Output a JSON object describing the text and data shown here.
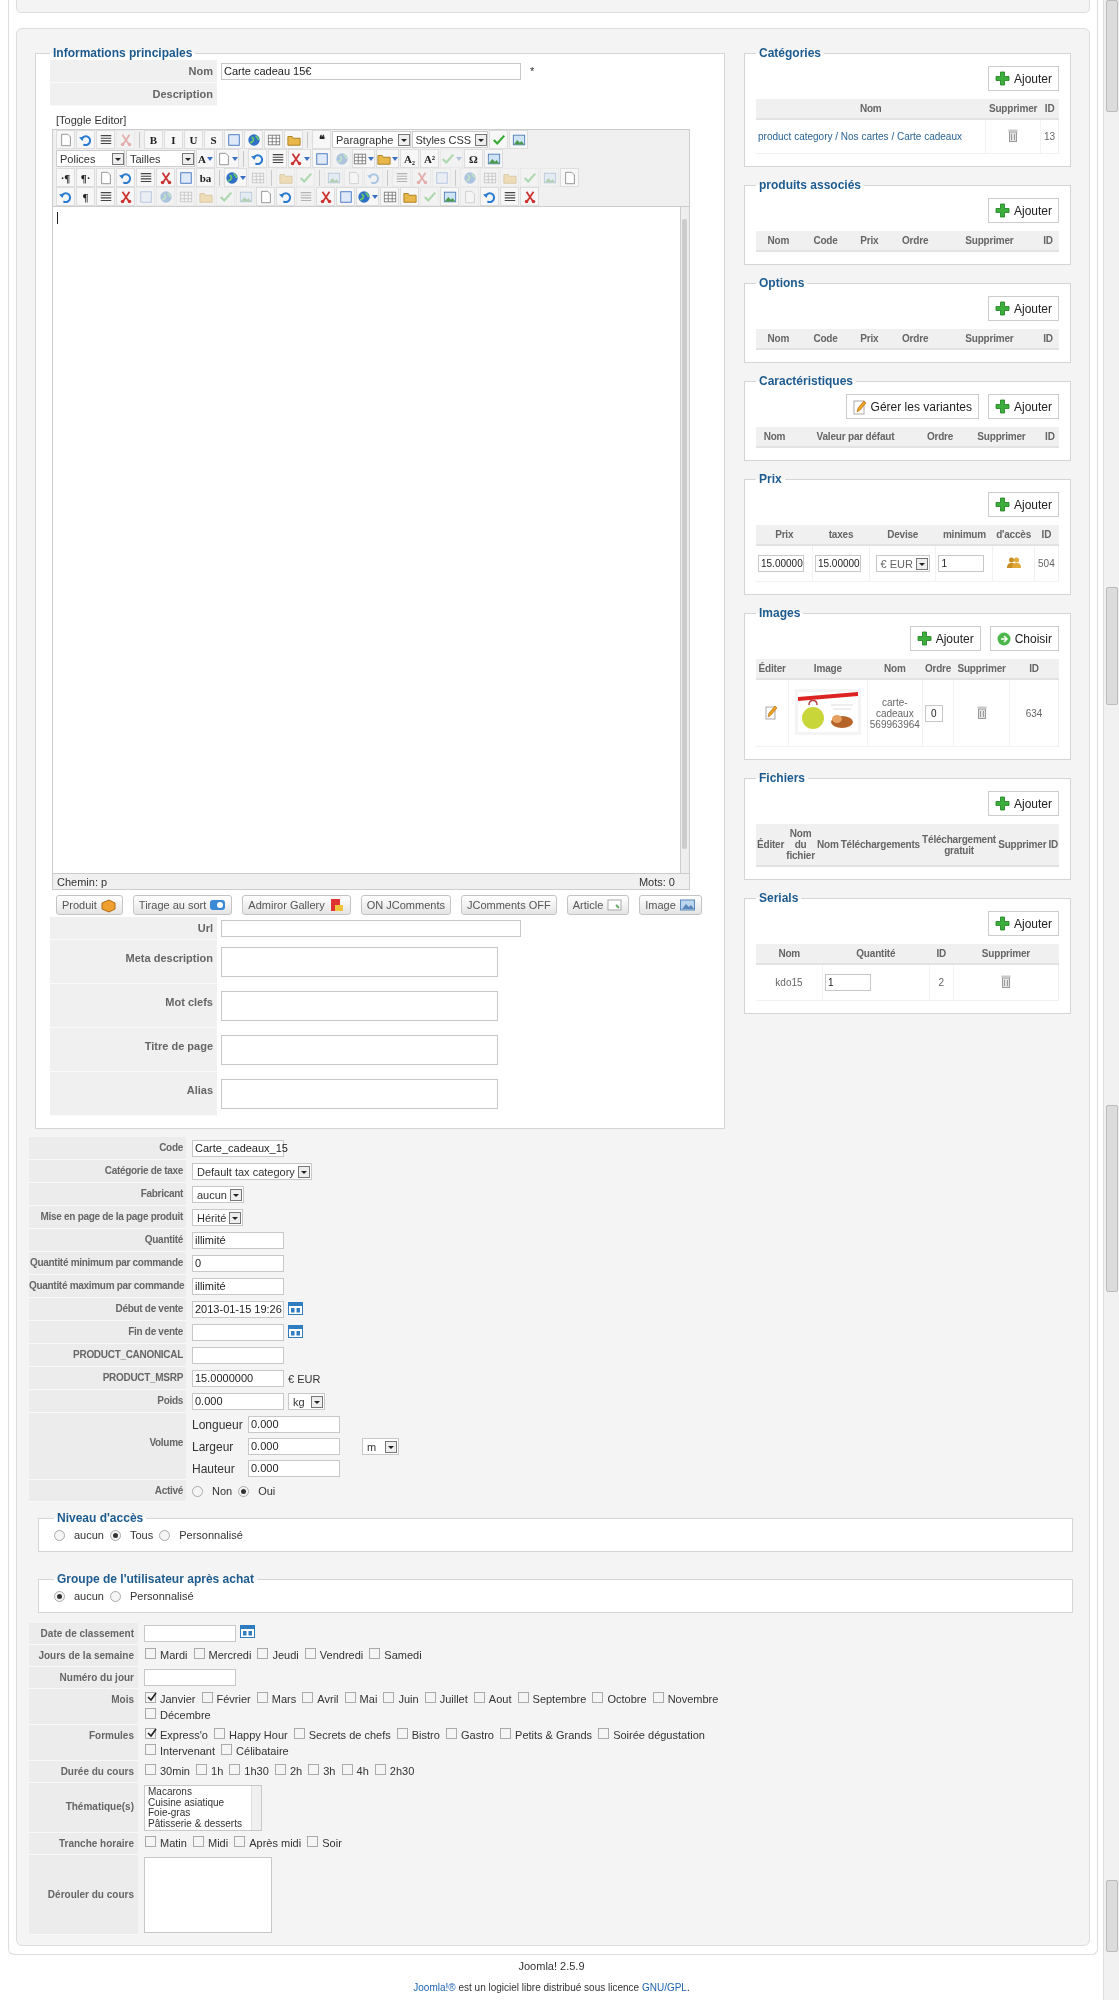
{
  "main_info": {
    "legend": "Informations principales",
    "name_field": {
      "label": "Nom",
      "value": "Carte cadeau 15€",
      "required_mark": "*"
    },
    "description_label": "Description",
    "editor": {
      "toggle": "[Toggle Editor]",
      "path": "Chemin: p",
      "word_count": "Mots: 0",
      "toolbar": [
        [
          {
            "kind": "btn",
            "disabled": false
          },
          {
            "kind": "btn",
            "disabled": false
          },
          {
            "kind": "btn",
            "disabled": false
          },
          {
            "kind": "btn",
            "disabled": true
          },
          {
            "kind": "sep"
          },
          {
            "kind": "btn",
            "glyph": "B",
            "disabled": false
          },
          {
            "kind": "btn",
            "glyph": "I",
            "disabled": false
          },
          {
            "kind": "btn",
            "glyph": "U",
            "disabled": false
          },
          {
            "kind": "btn",
            "glyph": "S",
            "disabled": false
          },
          {
            "kind": "btn",
            "disabled": false
          },
          {
            "kind": "btn",
            "disabled": false
          },
          {
            "kind": "btn",
            "disabled": false
          },
          {
            "kind": "btn",
            "disabled": false
          },
          {
            "kind": "sep"
          },
          {
            "kind": "btn",
            "glyph": "❝",
            "disabled": false
          },
          {
            "kind": "select",
            "value": "Paragraphe"
          },
          {
            "kind": "select",
            "value": "Styles CSS"
          },
          {
            "kind": "btn",
            "disabled": false
          },
          {
            "kind": "btn",
            "disabled": false
          }
        ],
        [
          {
            "kind": "select",
            "value": "Polices"
          },
          {
            "kind": "select",
            "value": "Tailles"
          },
          {
            "kind": "split",
            "glyph": "A",
            "disabled": false
          },
          {
            "kind": "split",
            "disabled": false
          },
          {
            "kind": "sep"
          },
          {
            "kind": "btn",
            "disabled": false
          },
          {
            "kind": "btn",
            "disabled": false
          },
          {
            "kind": "split",
            "disabled": false
          },
          {
            "kind": "btn",
            "disabled": false
          },
          {
            "kind": "btn",
            "disabled": true
          },
          {
            "kind": "split",
            "disabled": false
          },
          {
            "kind": "split",
            "disabled": false
          },
          {
            "kind": "btn",
            "glyph": "A₂",
            "disabled": false
          },
          {
            "kind": "btn",
            "glyph": "A²",
            "disabled": false
          },
          {
            "kind": "split",
            "disabled": true
          },
          {
            "kind": "btn",
            "glyph": "Ω",
            "disabled": false
          },
          {
            "kind": "btn",
            "disabled": false
          }
        ],
        [
          {
            "kind": "btn",
            "glyph": "·¶",
            "disabled": false
          },
          {
            "kind": "btn",
            "glyph": "¶·",
            "disabled": false
          },
          {
            "kind": "btn",
            "disabled": false
          },
          {
            "kind": "btn",
            "disabled": false
          },
          {
            "kind": "btn",
            "disabled": false
          },
          {
            "kind": "btn",
            "disabled": false
          },
          {
            "kind": "btn",
            "disabled": false
          },
          {
            "kind": "btn",
            "glyph": "ba",
            "disabled": false
          },
          {
            "kind": "sep"
          },
          {
            "kind": "split",
            "disabled": false
          },
          {
            "kind": "btn",
            "disabled": true
          },
          {
            "kind": "sep"
          },
          {
            "kind": "btn",
            "disabled": true
          },
          {
            "kind": "btn",
            "disabled": true
          },
          {
            "kind": "sep"
          },
          {
            "kind": "btn",
            "disabled": true
          },
          {
            "kind": "btn",
            "disabled": true
          },
          {
            "kind": "btn",
            "disabled": true
          },
          {
            "kind": "sep"
          },
          {
            "kind": "btn",
            "disabled": true
          },
          {
            "kind": "btn",
            "disabled": true
          },
          {
            "kind": "btn",
            "disabled": true
          },
          {
            "kind": "sep"
          },
          {
            "kind": "btn",
            "disabled": true
          },
          {
            "kind": "btn",
            "disabled": true
          },
          {
            "kind": "btn",
            "disabled": true
          },
          {
            "kind": "btn",
            "disabled": true
          },
          {
            "kind": "btn",
            "disabled": true
          },
          {
            "kind": "btn",
            "disabled": false
          }
        ],
        [
          {
            "kind": "btn",
            "disabled": false
          },
          {
            "kind": "btn",
            "glyph": "¶",
            "disabled": false
          },
          {
            "kind": "btn",
            "disabled": false
          },
          {
            "kind": "btn",
            "disabled": false
          },
          {
            "kind": "btn",
            "disabled": true
          },
          {
            "kind": "btn",
            "disabled": true
          },
          {
            "kind": "btn",
            "disabled": true
          },
          {
            "kind": "btn",
            "disabled": true
          },
          {
            "kind": "btn",
            "disabled": true
          },
          {
            "kind": "btn",
            "disabled": true
          },
          {
            "kind": "btn",
            "disabled": false
          },
          {
            "kind": "btn",
            "disabled": false
          },
          {
            "kind": "btn",
            "disabled": true
          },
          {
            "kind": "btn",
            "disabled": false
          },
          {
            "kind": "btn",
            "disabled": false
          },
          {
            "kind": "split",
            "disabled": false
          },
          {
            "kind": "btn",
            "disabled": false
          },
          {
            "kind": "btn",
            "disabled": false
          },
          {
            "kind": "btn",
            "disabled": true
          },
          {
            "kind": "btn",
            "disabled": false
          },
          {
            "kind": "btn",
            "disabled": true
          },
          {
            "kind": "btn",
            "disabled": false
          },
          {
            "kind": "btn",
            "disabled": false
          },
          {
            "kind": "btn",
            "disabled": false
          }
        ]
      ]
    },
    "extension_buttons": [
      {
        "label": "Produit",
        "kind": "icon"
      },
      {
        "label": "Tirage au sort",
        "kind": "icon"
      },
      {
        "label": "Admiror Gallery",
        "kind": "icon"
      },
      {
        "label": "ON JComments",
        "kind": "plain"
      },
      {
        "label": "JComments OFF",
        "kind": "plain"
      },
      {
        "label": "Article",
        "kind": "icon"
      },
      {
        "label": "Image",
        "kind": "icon"
      }
    ],
    "meta_fields": [
      {
        "label": "Url",
        "kind": "line"
      },
      {
        "label": "Meta description",
        "kind": "area"
      },
      {
        "label": "Mot clefs",
        "kind": "area"
      },
      {
        "label": "Titre de page",
        "kind": "area"
      },
      {
        "label": "Alias",
        "kind": "area"
      }
    ]
  },
  "product_fields": [
    {
      "label": "Code",
      "kind": "text",
      "value": "Carte_cadeaux_15"
    },
    {
      "label": "Catégorie de taxe",
      "kind": "select",
      "value": "Default tax category"
    },
    {
      "label": "Fabricant",
      "kind": "select",
      "value": "aucun"
    },
    {
      "label": "Mise en page de la page produit",
      "kind": "select",
      "value": "Hérité"
    },
    {
      "label": "Quantité",
      "kind": "text",
      "value": "illimité"
    },
    {
      "label": "Quantité minimum par commande",
      "kind": "text",
      "value": "0"
    },
    {
      "label": "Quantité maximum par commande",
      "kind": "text",
      "value": "illimité"
    },
    {
      "label": "Début de vente",
      "kind": "date",
      "value": "2013-01-15 19:26"
    },
    {
      "label": "Fin de vente",
      "kind": "date"
    },
    {
      "label": "PRODUCT_CANONICAL",
      "kind": "text"
    },
    {
      "label": "PRODUCT_MSRP",
      "kind": "price",
      "value": "15.0000000",
      "suffix": "€ EUR"
    },
    {
      "label": "Poids",
      "kind": "measure",
      "value": "0.000",
      "unit": "kg"
    },
    {
      "label": "Volume",
      "kind": "volume",
      "dims": [
        {
          "label": "Longueur",
          "value": "0.000"
        },
        {
          "label": "Largeur",
          "value": "0.000",
          "unit": "m"
        },
        {
          "label": "Hauteur",
          "value": "0.000"
        }
      ]
    },
    {
      "label": "Activé",
      "kind": "radios",
      "options": [
        {
          "label": "Non",
          "selected": false
        },
        {
          "label": "Oui",
          "selected": true
        }
      ]
    }
  ],
  "access_level": {
    "legend": "Niveau d'accès",
    "options": [
      {
        "label": "aucun",
        "selected": false
      },
      {
        "label": "Tous",
        "selected": true
      },
      {
        "label": "Personnalisé",
        "selected": false
      }
    ]
  },
  "user_group": {
    "legend": "Groupe de l'utilisateur après achat",
    "options": [
      {
        "label": "aucun",
        "selected": true
      },
      {
        "label": "Personnalisé",
        "selected": false
      }
    ]
  },
  "extra_fields": [
    {
      "label": "Date de classement",
      "kind": "date"
    },
    {
      "label": "Jours de la semaine",
      "kind": "checks",
      "options": [
        {
          "label": "Mardi",
          "checked": false
        },
        {
          "label": "Mercredi",
          "checked": false
        },
        {
          "label": "Jeudi",
          "checked": false
        },
        {
          "label": "Vendredi",
          "checked": false
        },
        {
          "label": "Samedi",
          "checked": false
        }
      ]
    },
    {
      "label": "Numéro du jour",
      "kind": "text"
    },
    {
      "label": "Mois",
      "kind": "checks",
      "options": [
        {
          "label": "Janvier",
          "checked": true
        },
        {
          "label": "Février",
          "checked": false
        },
        {
          "label": "Mars",
          "checked": false
        },
        {
          "label": "Avril",
          "checked": false
        },
        {
          "label": "Mai",
          "checked": false
        },
        {
          "label": "Juin",
          "checked": false
        },
        {
          "label": "Juillet",
          "checked": false
        },
        {
          "label": "Aout",
          "checked": false
        },
        {
          "label": "Septembre",
          "checked": false
        },
        {
          "label": "Octobre",
          "checked": false
        },
        {
          "label": "Novembre",
          "checked": false
        },
        {
          "label": "Décembre",
          "checked": false
        }
      ]
    },
    {
      "label": "Formules",
      "kind": "checks",
      "options": [
        {
          "label": "Express'o",
          "checked": true
        },
        {
          "label": "Happy Hour",
          "checked": false
        },
        {
          "label": "Secrets de chefs",
          "checked": false
        },
        {
          "label": "Bistro",
          "checked": false
        },
        {
          "label": "Gastro",
          "checked": false
        },
        {
          "label": "Petits & Grands",
          "checked": false
        },
        {
          "label": "Soirée dégustation",
          "checked": false
        },
        {
          "label": "Intervenant",
          "checked": false
        },
        {
          "label": "Célibataire",
          "checked": false
        }
      ]
    },
    {
      "label": "Durée du cours",
      "kind": "checks",
      "options": [
        {
          "label": "30min",
          "checked": false
        },
        {
          "label": "1h",
          "checked": false
        },
        {
          "label": "1h30",
          "checked": false
        },
        {
          "label": "2h",
          "checked": false
        },
        {
          "label": "3h",
          "checked": false
        },
        {
          "label": "4h",
          "checked": false
        },
        {
          "label": "2h30",
          "checked": false
        }
      ]
    },
    {
      "label": "Thématique(s)",
      "kind": "listbox",
      "options": [
        "Macarons",
        "Cuisine asiatique",
        "Foie-gras",
        "Pâtisserie & desserts"
      ]
    },
    {
      "label": "Tranche horaire",
      "kind": "checks",
      "options": [
        {
          "label": "Matin",
          "checked": false
        },
        {
          "label": "Midi",
          "checked": false
        },
        {
          "label": "Après midi",
          "checked": false
        },
        {
          "label": "Soir",
          "checked": false
        }
      ]
    },
    {
      "label": "Dérouler du cours",
      "kind": "textarea"
    }
  ],
  "right_panels": [
    {
      "legend": "Catégories",
      "buttons": [
        {
          "label": "Ajouter",
          "kind": "add"
        }
      ],
      "columns": [
        "Nom",
        "Supprimer",
        "ID"
      ],
      "rows": [
        [
          {
            "kind": "link",
            "text": "product category / Nos cartes / Carte cadeaux"
          },
          {
            "kind": "trash"
          },
          {
            "kind": "text",
            "text": "13"
          }
        ]
      ]
    },
    {
      "legend": "produits associés",
      "buttons": [
        {
          "label": "Ajouter",
          "kind": "add"
        }
      ],
      "columns": [
        "Nom",
        "Code",
        "Prix",
        "Ordre",
        "Supprimer",
        "ID"
      ]
    },
    {
      "legend": "Options",
      "buttons": [
        {
          "label": "Ajouter",
          "kind": "add"
        }
      ],
      "columns": [
        "Nom",
        "Code",
        "Prix",
        "Ordre",
        "Supprimer",
        "ID"
      ]
    },
    {
      "legend": "Caractéristiques",
      "buttons": [
        {
          "label": "Gérer les variantes",
          "kind": "variants"
        },
        {
          "label": "Ajouter",
          "kind": "add"
        }
      ],
      "columns": [
        "Nom",
        "Valeur par défaut",
        "Ordre",
        "Supprimer",
        "ID"
      ]
    },
    {
      "legend": "Prix",
      "buttons": [
        {
          "label": "Ajouter",
          "kind": "add"
        }
      ],
      "columns": [
        "Prix",
        "taxes",
        "Devise",
        "minimum",
        "d'accès",
        "ID"
      ],
      "rows": [
        [
          {
            "kind": "input",
            "value": "15.00000"
          },
          {
            "kind": "input",
            "value": "15.00000"
          },
          {
            "kind": "select",
            "value": "€ EUR"
          },
          {
            "kind": "input",
            "value": "1"
          },
          {
            "kind": "access"
          },
          {
            "kind": "text",
            "text": "504"
          }
        ]
      ]
    },
    {
      "legend": "Images",
      "buttons": [
        {
          "label": "Ajouter",
          "kind": "add"
        },
        {
          "label": "Choisir",
          "kind": "choose"
        }
      ],
      "columns": [
        "Éditer",
        "Image",
        "Nom",
        "Ordre",
        "Supprimer",
        "ID"
      ],
      "rows": [
        [
          {
            "kind": "edit"
          },
          {
            "kind": "picture"
          },
          {
            "kind": "text",
            "text": "carte-cadeaux 569963964"
          },
          {
            "kind": "input",
            "value": "0"
          },
          {
            "kind": "trash"
          },
          {
            "kind": "text",
            "text": "634"
          }
        ]
      ]
    },
    {
      "legend": "Fichiers",
      "buttons": [
        {
          "label": "Ajouter",
          "kind": "add"
        }
      ],
      "columns": [
        "Éditer",
        "Nom du fichier",
        "Nom",
        "Téléchargements",
        "Téléchargement gratuit",
        "Supprimer",
        "ID"
      ]
    },
    {
      "legend": "Serials",
      "buttons": [
        {
          "label": "Ajouter",
          "kind": "add"
        }
      ],
      "columns": [
        "Nom",
        "Quantité",
        "ID",
        "Supprimer"
      ],
      "rows": [
        [
          {
            "kind": "text",
            "text": "kdo15"
          },
          {
            "kind": "input",
            "value": "1"
          },
          {
            "kind": "text",
            "text": "2"
          },
          {
            "kind": "trash"
          }
        ]
      ]
    }
  ],
  "footer": {
    "version": "Joomla! 2.5.9",
    "license": [
      {
        "text": "Joomla!®",
        "link": true
      },
      {
        "text": " est un logiciel libre distribué sous licence ",
        "link": false
      },
      {
        "text": "GNU/GPL",
        "link": true
      },
      {
        "text": ".",
        "link": false
      }
    ]
  }
}
